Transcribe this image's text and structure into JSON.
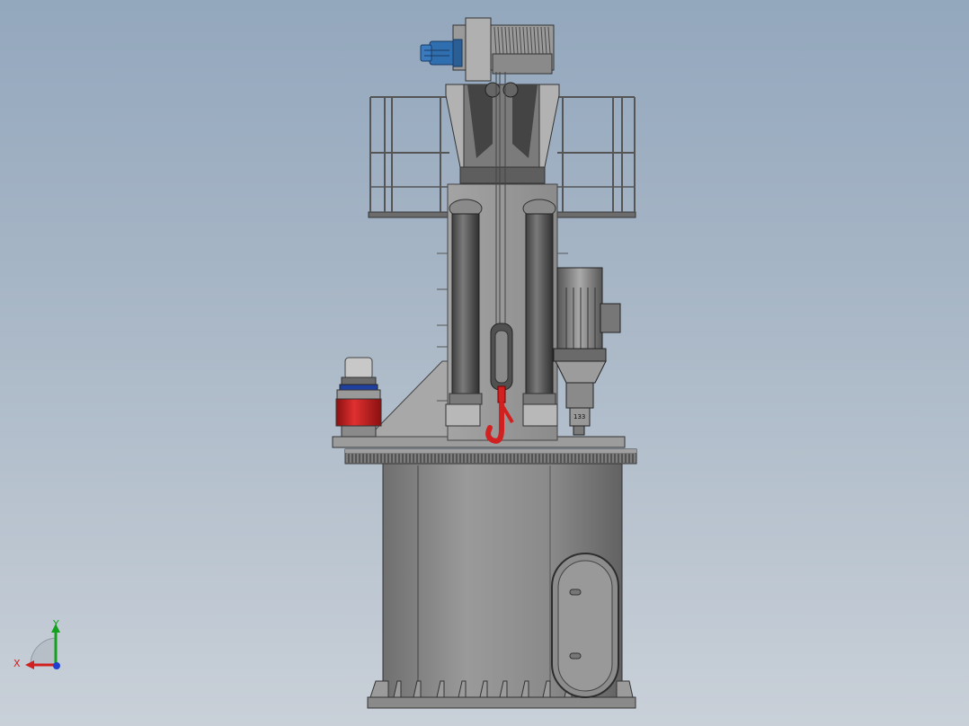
{
  "viewport": {
    "background_top": "#93a7bd",
    "background_bottom": "#c9d0d8"
  },
  "model": {
    "description_icon": "crane-assembly-icon",
    "colors": {
      "steel": "#8f8f8f",
      "steel_dark": "#5d5d5d",
      "steel_light": "#c4c4c4",
      "hook": "#d02020",
      "motor_blue": "#2f6fb0",
      "bearing_red": "#c81e1e"
    }
  },
  "triad": {
    "x_label": "X",
    "y_label": "Y",
    "x_color": "#d02020",
    "y_color": "#16a020",
    "z_color": "#2040d0"
  },
  "motor": {
    "nameplate_text": "133"
  }
}
